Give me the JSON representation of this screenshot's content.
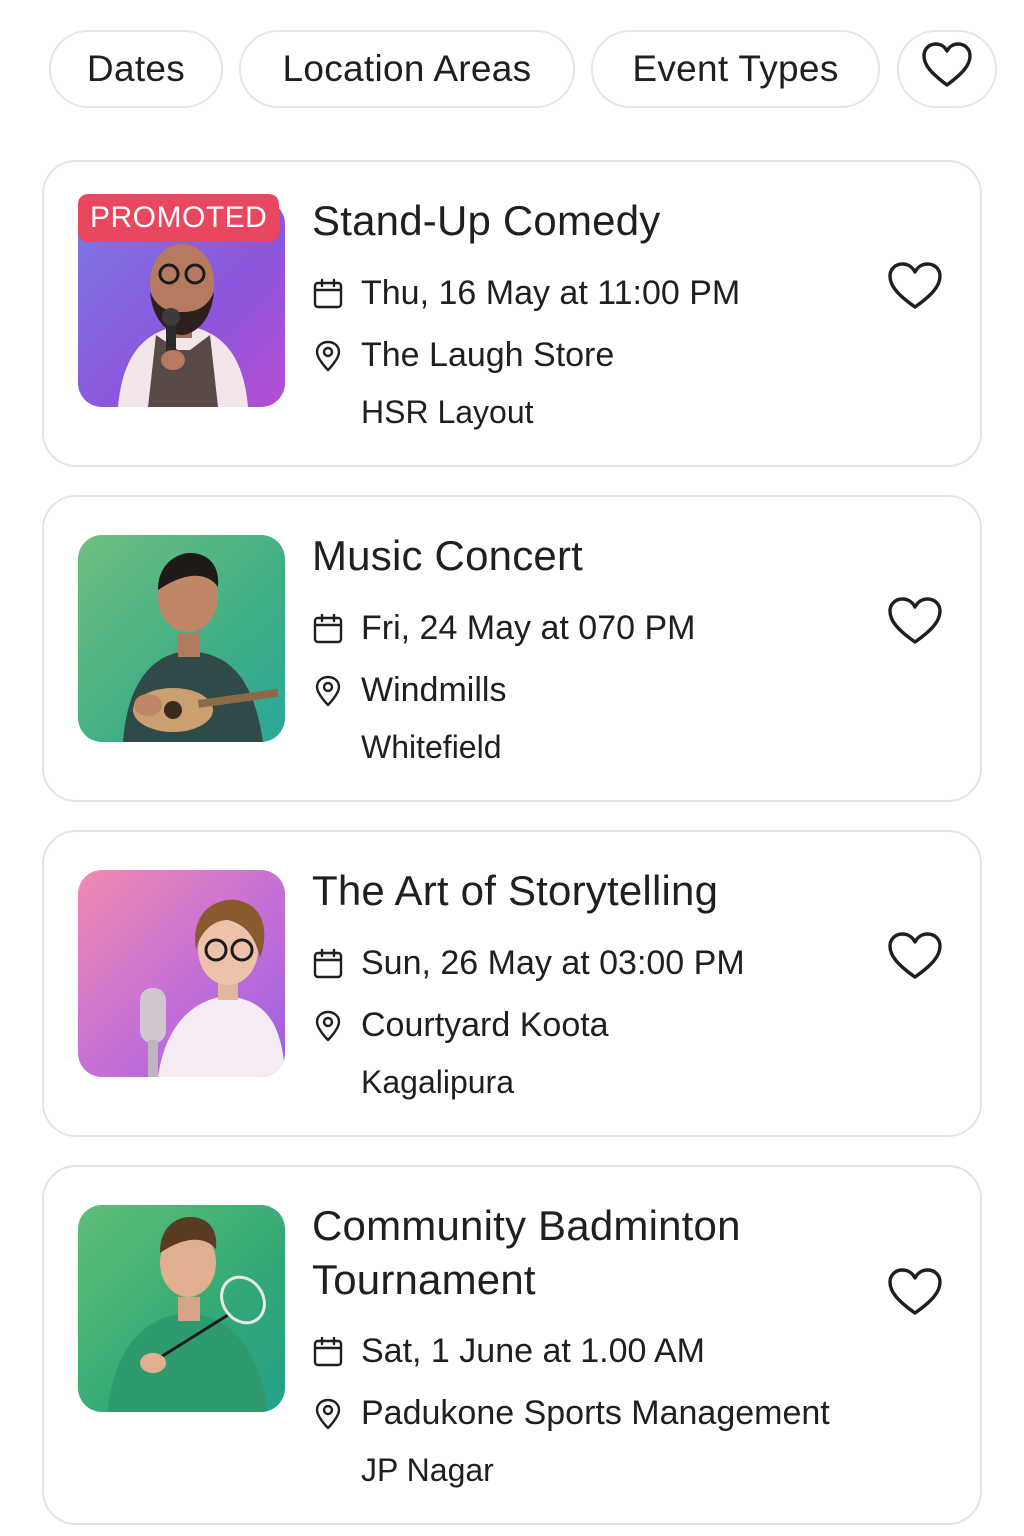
{
  "filters": {
    "dates": "Dates",
    "location_areas": "Location Areas",
    "event_types": "Event Types",
    "favorites_icon": "heart-icon"
  },
  "events": [
    {
      "badge": "PROMOTED",
      "title": "Stand-Up Comedy",
      "date": "Thu, 16 May at 11:00 PM",
      "venue": "The Laugh Store",
      "area": "HSR Layout",
      "favorite_icon": "heart-icon"
    },
    {
      "title": "Music Concert",
      "date": "Fri, 24 May at 070 PM",
      "venue": "Windmills",
      "area": "Whitefield",
      "favorite_icon": "heart-icon"
    },
    {
      "title": "The Art of Storytelling",
      "date": "Sun, 26 May at 03:00 PM",
      "venue": "Courtyard Koota",
      "area": "Kagalipura",
      "favorite_icon": "heart-icon"
    },
    {
      "title": "Community Badminton Tournament",
      "date": "Sat, 1 June at 1.00 AM",
      "venue": "Padukone Sports Management",
      "area": "JP Nagar",
      "favorite_icon": "heart-icon"
    }
  ],
  "colors": {
    "promoted_badge": "#e8475f",
    "card_border": "#e4e4e4",
    "text": "#1f1f1f"
  }
}
